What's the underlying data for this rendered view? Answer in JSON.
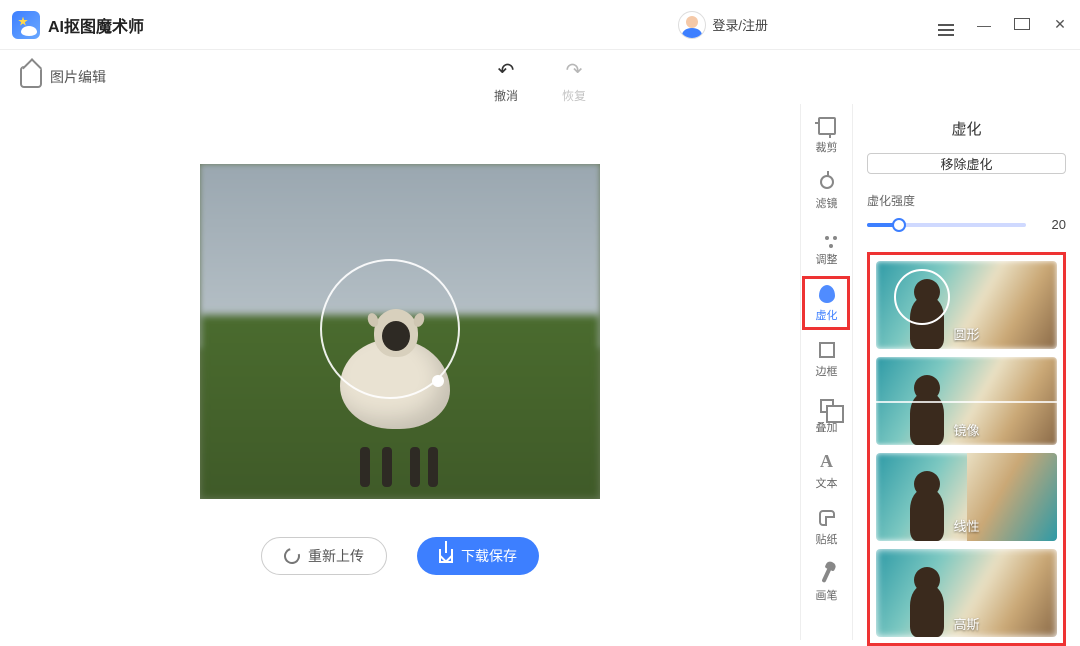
{
  "app": {
    "title": "AI抠图魔术师"
  },
  "header": {
    "login": "登录/注册"
  },
  "subbar": {
    "breadcrumb": "图片编辑",
    "undo": "撤消",
    "redo": "恢复"
  },
  "actions": {
    "reupload": "重新上传",
    "download": "下载保存"
  },
  "rail": {
    "items": [
      {
        "key": "crop",
        "label": "裁剪"
      },
      {
        "key": "filter",
        "label": "滤镜"
      },
      {
        "key": "adjust",
        "label": "调整"
      },
      {
        "key": "blur",
        "label": "虚化"
      },
      {
        "key": "border",
        "label": "边框"
      },
      {
        "key": "overlay",
        "label": "叠加"
      },
      {
        "key": "text",
        "label": "文本"
      },
      {
        "key": "sticker",
        "label": "贴纸"
      },
      {
        "key": "brush",
        "label": "画笔"
      }
    ],
    "active": "blur"
  },
  "panel": {
    "title": "虚化",
    "remove": "移除虚化",
    "sliderLabel": "虚化强度",
    "sliderValue": "20",
    "modes": [
      {
        "key": "circle",
        "label": "圆形"
      },
      {
        "key": "mirror",
        "label": "镜像"
      },
      {
        "key": "linear",
        "label": "线性"
      },
      {
        "key": "gaussian",
        "label": "高斯"
      }
    ]
  }
}
